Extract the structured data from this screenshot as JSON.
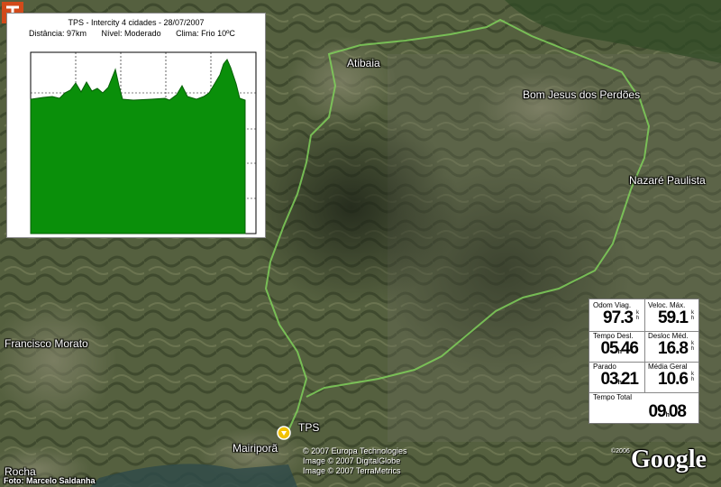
{
  "map": {
    "cities": [
      {
        "id": "atibaia",
        "name": "Atibaia"
      },
      {
        "id": "bomjesus",
        "name": "Bom Jesus dos Perdões"
      },
      {
        "id": "nazare",
        "name": "Nazaré Paulista"
      },
      {
        "id": "francisco",
        "name": "Francisco Morato"
      },
      {
        "id": "mairipora",
        "name": "Mairiporã"
      },
      {
        "id": "rocha",
        "name": "Rocha"
      }
    ],
    "marker_label": "TPS",
    "credits": [
      "© 2007 Europa Technologies",
      "Image © 2007 DigitalGlobe",
      "Image © 2007 TerraMetrics"
    ],
    "google_year": "©2006",
    "google_logo": "Google",
    "photo_credit": "Foto: Marcelo Saldanha",
    "track_color": "#7fcf5a"
  },
  "profile": {
    "title": "TPS - Intercity 4 cidades - 28/07/2007",
    "distance": "Distância: 97km",
    "level": "Nível: Moderado",
    "weather": "Clima: Frio 10ºC",
    "fill_color": "#0a8f0a"
  },
  "stats": {
    "odom": {
      "label": "Odom Viag.",
      "value": "97.3",
      "unit_top": "k",
      "unit_bot": "h"
    },
    "vmax": {
      "label": "Veloc. Máx.",
      "value": "59.1",
      "unit_top": "k",
      "unit_bot": "h"
    },
    "tdesl": {
      "label": "Tempo Desl.",
      "h": "05",
      "m": "46"
    },
    "dmed": {
      "label": "Desloc Méd.",
      "value": "16.8",
      "unit_top": "k",
      "unit_bot": "h"
    },
    "parado": {
      "label": "Parado",
      "h": "03",
      "m": "21"
    },
    "mgeral": {
      "label": "Média Geral",
      "value": "10.6",
      "unit_top": "k",
      "unit_bot": "h"
    },
    "total": {
      "label": "Tempo Total",
      "h": "09",
      "m": "08"
    }
  }
}
